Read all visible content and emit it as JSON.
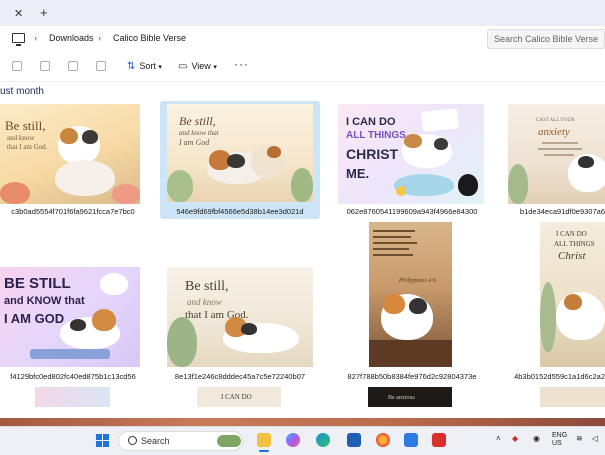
{
  "window": {
    "tab_close_glyph": "✕",
    "new_tab_glyph": "+"
  },
  "address": {
    "sep": "›",
    "crumbs": [
      "Downloads",
      "Calico Bible Verse"
    ],
    "search_placeholder": "Search Calico Bible Verse"
  },
  "toolbar": {
    "sort_label": "Sort",
    "view_label": "View",
    "more_glyph": "···"
  },
  "section": {
    "title": "ust month"
  },
  "files": [
    {
      "name": "c3b0ad5554f701f6fa9621fcca7e7bc0",
      "art": [
        "Be still,",
        "and know",
        "that I am God."
      ]
    },
    {
      "name": "546e9fd69fbf4566e5d38b14ee3d021d",
      "art": [
        "Be still,",
        "and know that",
        "I am God"
      ]
    },
    {
      "name": "062e8760541199609a943f4966e84300",
      "art": [
        "I CAN DO",
        "ALL THINGS",
        "CHRIST",
        "ME."
      ]
    },
    {
      "name": "b1de34eca91df0e9307a6",
      "art": [
        "CAST ALL YOUR",
        "anxiety"
      ]
    },
    {
      "name": "f4129bfc0ed802fc40ed875b1c13cd56",
      "art": [
        "BE STILL",
        "and KNOW that",
        "I AM GOD"
      ]
    },
    {
      "name": "8e13f1e246c8dddec45a7c5e72240b07",
      "art": [
        "Be still,",
        "and know",
        "that I am God."
      ]
    },
    {
      "name": "827f788b50b8384fe976d2c92804373e",
      "art": [
        "Philippians 4:6"
      ]
    },
    {
      "name": "4b3b0152d559c1a1d6c2a2",
      "art": [
        "I CAN DO",
        "ALL THINGS",
        "Christ"
      ]
    }
  ],
  "partial_row": {
    "art": [
      "I CAN DO",
      "Be anxious"
    ]
  },
  "taskbar": {
    "search_label": "Search",
    "lang": "ENG",
    "region": "US"
  },
  "colors": {
    "selection": "#cde6f7",
    "section_title": "#1c2a63",
    "taskbar": "#eef0f6"
  }
}
